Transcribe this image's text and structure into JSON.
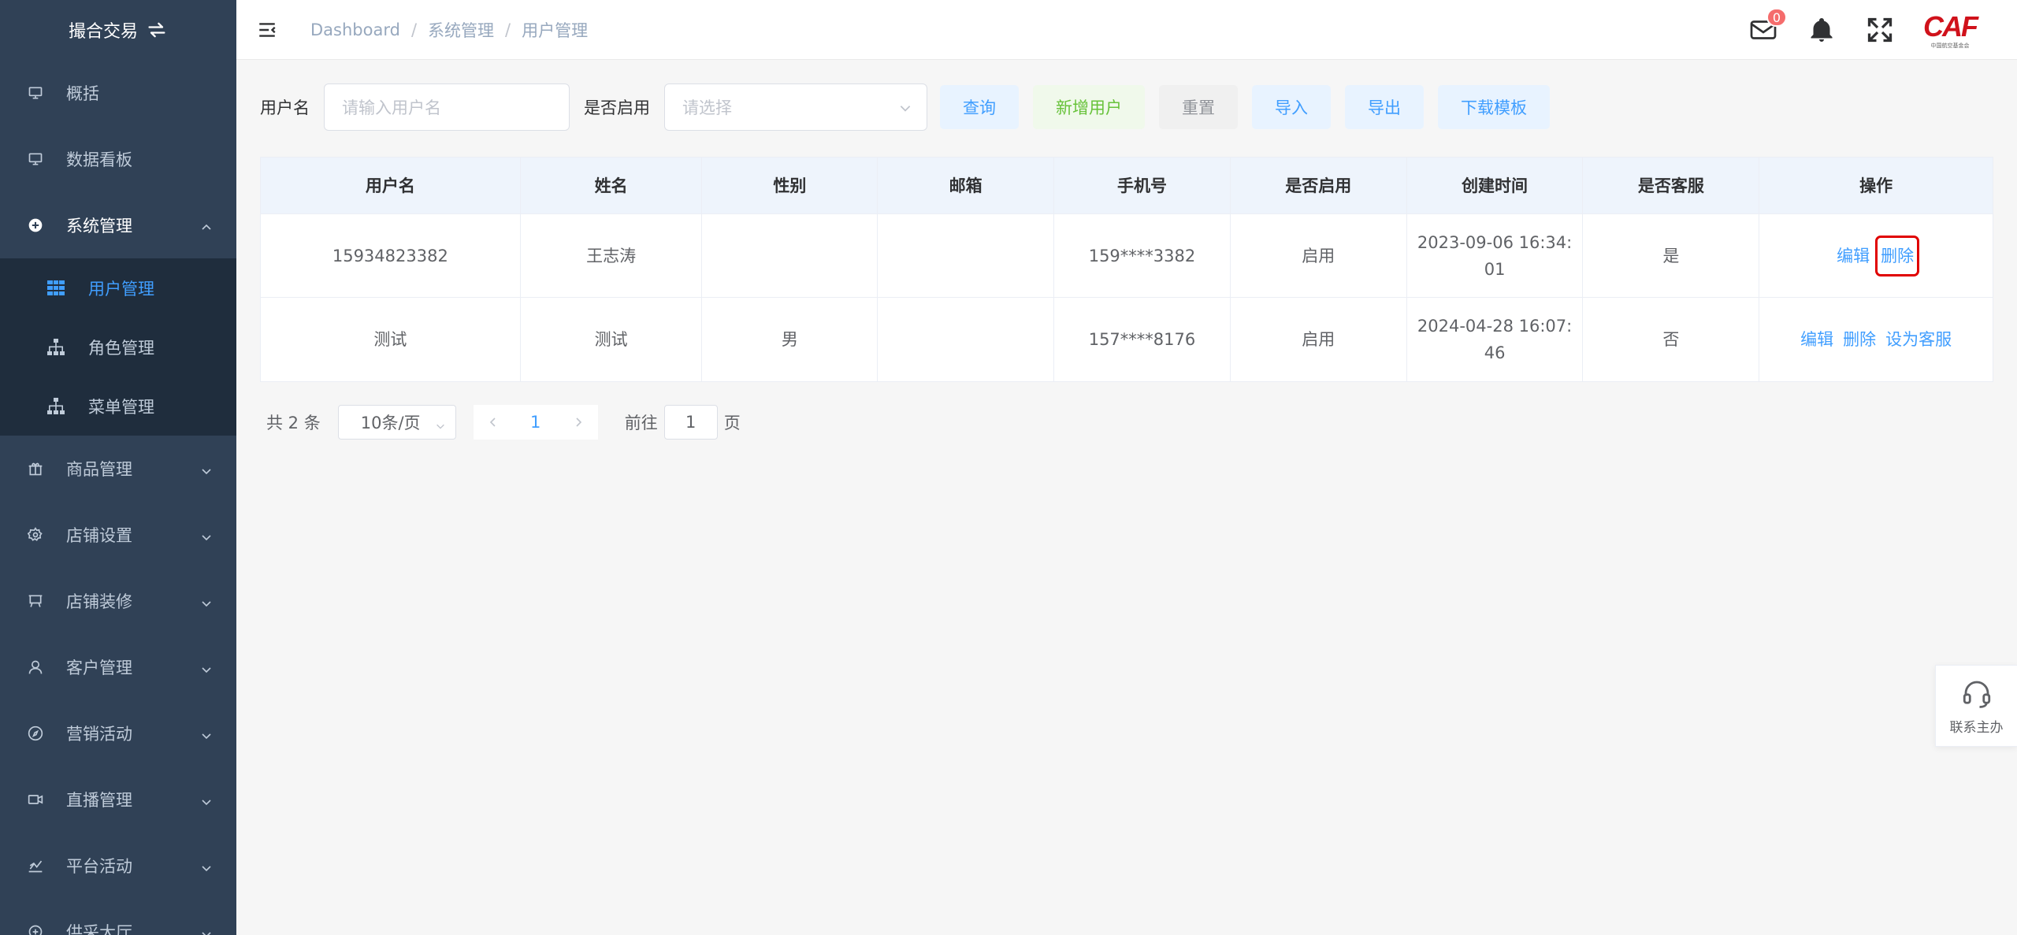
{
  "sidebar": {
    "logo_text": "撮合交易",
    "items": [
      {
        "label": "概括",
        "icon": "monitor-icon"
      },
      {
        "label": "数据看板",
        "icon": "monitor-icon"
      },
      {
        "label": "系统管理",
        "icon": "plus-circle-icon"
      },
      {
        "label": "商品管理",
        "icon": "box-icon"
      },
      {
        "label": "店铺设置",
        "icon": "gear-icon"
      },
      {
        "label": "店铺装修",
        "icon": "easel-icon"
      },
      {
        "label": "客户管理",
        "icon": "user-icon"
      },
      {
        "label": "营销活动",
        "icon": "compass-icon"
      },
      {
        "label": "直播管理",
        "icon": "video-icon"
      },
      {
        "label": "平台活动",
        "icon": "chart-icon"
      },
      {
        "label": "供采大厅",
        "icon": "hall-icon"
      }
    ],
    "submenu": [
      {
        "label": "用户管理",
        "icon": "table-icon"
      },
      {
        "label": "角色管理",
        "icon": "tree-icon"
      },
      {
        "label": "菜单管理",
        "icon": "tree-icon"
      }
    ]
  },
  "header": {
    "breadcrumb": [
      "Dashboard",
      "系统管理",
      "用户管理"
    ],
    "separator": "/",
    "mail_badge": "0",
    "brand": "CAF",
    "brand_sub": "中国航空基金会"
  },
  "filter": {
    "username_label": "用户名",
    "username_placeholder": "请输入用户名",
    "enabled_label": "是否启用",
    "enabled_placeholder": "请选择",
    "buttons": {
      "query": "查询",
      "add_user": "新增用户",
      "reset": "重置",
      "import": "导入",
      "export": "导出",
      "download_template": "下载模板"
    }
  },
  "table": {
    "columns": [
      "用户名",
      "姓名",
      "性别",
      "邮箱",
      "手机号",
      "是否启用",
      "创建时间",
      "是否客服",
      "操作"
    ],
    "rows": [
      {
        "username": "15934823382",
        "name": "王志涛",
        "gender": "",
        "email": "",
        "phone": "159****3382",
        "enabled": "启用",
        "created": "2023-09-06 16:34:01",
        "is_service": "是",
        "actions": [
          "编辑",
          "删除"
        ]
      },
      {
        "username": "测试",
        "name": "测试",
        "gender": "男",
        "email": "",
        "phone": "157****8176",
        "enabled": "启用",
        "created": "2024-04-28 16:07:46",
        "is_service": "否",
        "actions": [
          "编辑",
          "删除",
          "设为客服"
        ]
      }
    ]
  },
  "pagination": {
    "total": "共 2 条",
    "page_size": "10条/页",
    "current": "1",
    "goto_prefix": "前往",
    "goto_value": "1",
    "goto_suffix": "页"
  },
  "float_service": {
    "label": "联系主办"
  }
}
